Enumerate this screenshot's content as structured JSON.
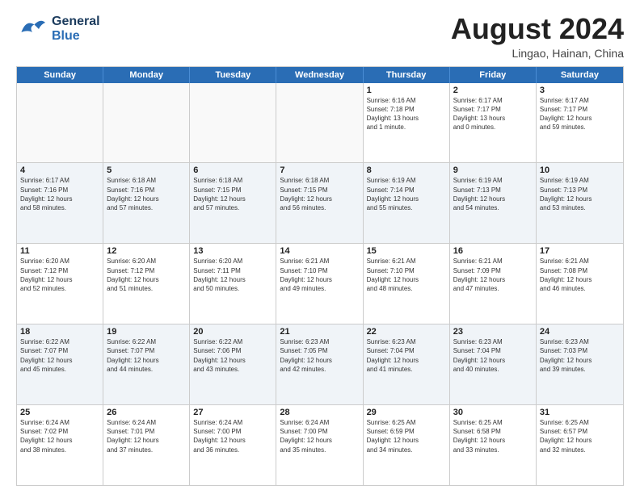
{
  "header": {
    "logo_general": "General",
    "logo_blue": "Blue",
    "main_title": "August 2024",
    "subtitle": "Lingao, Hainan, China"
  },
  "calendar": {
    "days_of_week": [
      "Sunday",
      "Monday",
      "Tuesday",
      "Wednesday",
      "Thursday",
      "Friday",
      "Saturday"
    ],
    "weeks": [
      [
        {
          "day": "",
          "info": ""
        },
        {
          "day": "",
          "info": ""
        },
        {
          "day": "",
          "info": ""
        },
        {
          "day": "",
          "info": ""
        },
        {
          "day": "1",
          "info": "Sunrise: 6:16 AM\nSunset: 7:18 PM\nDaylight: 13 hours\nand 1 minute."
        },
        {
          "day": "2",
          "info": "Sunrise: 6:17 AM\nSunset: 7:17 PM\nDaylight: 13 hours\nand 0 minutes."
        },
        {
          "day": "3",
          "info": "Sunrise: 6:17 AM\nSunset: 7:17 PM\nDaylight: 12 hours\nand 59 minutes."
        }
      ],
      [
        {
          "day": "4",
          "info": "Sunrise: 6:17 AM\nSunset: 7:16 PM\nDaylight: 12 hours\nand 58 minutes."
        },
        {
          "day": "5",
          "info": "Sunrise: 6:18 AM\nSunset: 7:16 PM\nDaylight: 12 hours\nand 57 minutes."
        },
        {
          "day": "6",
          "info": "Sunrise: 6:18 AM\nSunset: 7:15 PM\nDaylight: 12 hours\nand 57 minutes."
        },
        {
          "day": "7",
          "info": "Sunrise: 6:18 AM\nSunset: 7:15 PM\nDaylight: 12 hours\nand 56 minutes."
        },
        {
          "day": "8",
          "info": "Sunrise: 6:19 AM\nSunset: 7:14 PM\nDaylight: 12 hours\nand 55 minutes."
        },
        {
          "day": "9",
          "info": "Sunrise: 6:19 AM\nSunset: 7:13 PM\nDaylight: 12 hours\nand 54 minutes."
        },
        {
          "day": "10",
          "info": "Sunrise: 6:19 AM\nSunset: 7:13 PM\nDaylight: 12 hours\nand 53 minutes."
        }
      ],
      [
        {
          "day": "11",
          "info": "Sunrise: 6:20 AM\nSunset: 7:12 PM\nDaylight: 12 hours\nand 52 minutes."
        },
        {
          "day": "12",
          "info": "Sunrise: 6:20 AM\nSunset: 7:12 PM\nDaylight: 12 hours\nand 51 minutes."
        },
        {
          "day": "13",
          "info": "Sunrise: 6:20 AM\nSunset: 7:11 PM\nDaylight: 12 hours\nand 50 minutes."
        },
        {
          "day": "14",
          "info": "Sunrise: 6:21 AM\nSunset: 7:10 PM\nDaylight: 12 hours\nand 49 minutes."
        },
        {
          "day": "15",
          "info": "Sunrise: 6:21 AM\nSunset: 7:10 PM\nDaylight: 12 hours\nand 48 minutes."
        },
        {
          "day": "16",
          "info": "Sunrise: 6:21 AM\nSunset: 7:09 PM\nDaylight: 12 hours\nand 47 minutes."
        },
        {
          "day": "17",
          "info": "Sunrise: 6:21 AM\nSunset: 7:08 PM\nDaylight: 12 hours\nand 46 minutes."
        }
      ],
      [
        {
          "day": "18",
          "info": "Sunrise: 6:22 AM\nSunset: 7:07 PM\nDaylight: 12 hours\nand 45 minutes."
        },
        {
          "day": "19",
          "info": "Sunrise: 6:22 AM\nSunset: 7:07 PM\nDaylight: 12 hours\nand 44 minutes."
        },
        {
          "day": "20",
          "info": "Sunrise: 6:22 AM\nSunset: 7:06 PM\nDaylight: 12 hours\nand 43 minutes."
        },
        {
          "day": "21",
          "info": "Sunrise: 6:23 AM\nSunset: 7:05 PM\nDaylight: 12 hours\nand 42 minutes."
        },
        {
          "day": "22",
          "info": "Sunrise: 6:23 AM\nSunset: 7:04 PM\nDaylight: 12 hours\nand 41 minutes."
        },
        {
          "day": "23",
          "info": "Sunrise: 6:23 AM\nSunset: 7:04 PM\nDaylight: 12 hours\nand 40 minutes."
        },
        {
          "day": "24",
          "info": "Sunrise: 6:23 AM\nSunset: 7:03 PM\nDaylight: 12 hours\nand 39 minutes."
        }
      ],
      [
        {
          "day": "25",
          "info": "Sunrise: 6:24 AM\nSunset: 7:02 PM\nDaylight: 12 hours\nand 38 minutes."
        },
        {
          "day": "26",
          "info": "Sunrise: 6:24 AM\nSunset: 7:01 PM\nDaylight: 12 hours\nand 37 minutes."
        },
        {
          "day": "27",
          "info": "Sunrise: 6:24 AM\nSunset: 7:00 PM\nDaylight: 12 hours\nand 36 minutes."
        },
        {
          "day": "28",
          "info": "Sunrise: 6:24 AM\nSunset: 7:00 PM\nDaylight: 12 hours\nand 35 minutes."
        },
        {
          "day": "29",
          "info": "Sunrise: 6:25 AM\nSunset: 6:59 PM\nDaylight: 12 hours\nand 34 minutes."
        },
        {
          "day": "30",
          "info": "Sunrise: 6:25 AM\nSunset: 6:58 PM\nDaylight: 12 hours\nand 33 minutes."
        },
        {
          "day": "31",
          "info": "Sunrise: 6:25 AM\nSunset: 6:57 PM\nDaylight: 12 hours\nand 32 minutes."
        }
      ]
    ]
  }
}
